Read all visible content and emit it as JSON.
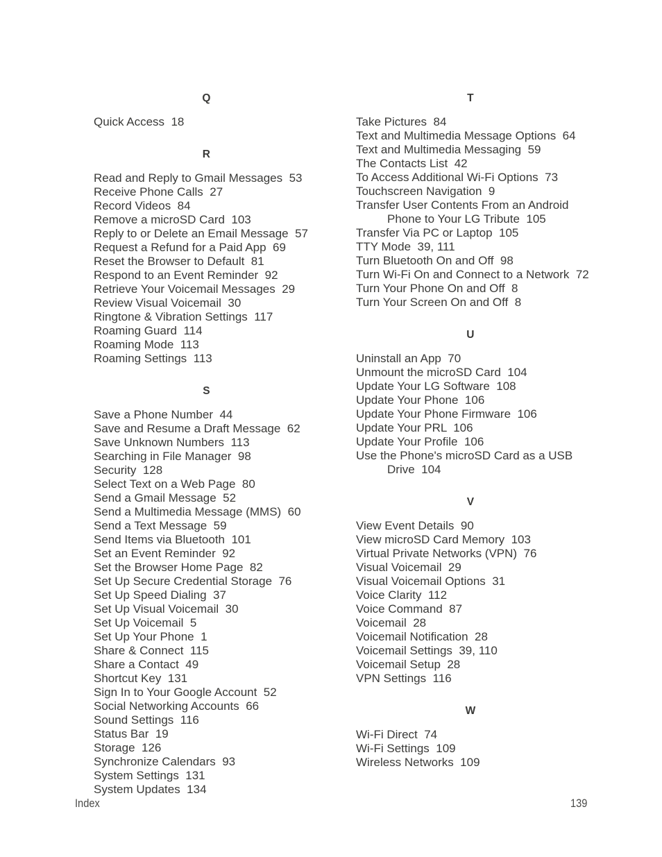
{
  "document": {
    "kind": "book-index-page",
    "page_number": "139",
    "footer_label": "Index"
  },
  "columns": [
    {
      "id": "left",
      "groups": [
        {
          "letter": "Q",
          "entries": [
            {
              "text": "Quick Access  18"
            }
          ]
        },
        {
          "letter": "R",
          "entries": [
            {
              "text": "Read and Reply to Gmail Messages  53"
            },
            {
              "text": "Receive Phone Calls  27"
            },
            {
              "text": "Record Videos  84"
            },
            {
              "text": "Remove a microSD Card  103"
            },
            {
              "text": "Reply to or Delete an Email Message  57"
            },
            {
              "text": "Request a Refund for a Paid App  69"
            },
            {
              "text": "Reset the Browser to Default  81"
            },
            {
              "text": "Respond to an Event Reminder  92"
            },
            {
              "text": "Retrieve Your Voicemail Messages  29"
            },
            {
              "text": "Review Visual Voicemail  30"
            },
            {
              "text": "Ringtone & Vibration Settings  117"
            },
            {
              "text": "Roaming Guard  114"
            },
            {
              "text": "Roaming Mode  113"
            },
            {
              "text": "Roaming Settings  113"
            }
          ]
        },
        {
          "letter": "S",
          "entries": [
            {
              "text": "Save a Phone Number  44"
            },
            {
              "text": "Save and Resume a Draft Message  62"
            },
            {
              "text": "Save Unknown Numbers  113"
            },
            {
              "text": "Searching in File Manager  98"
            },
            {
              "text": "Security  128"
            },
            {
              "text": "Select Text on a Web Page  80"
            },
            {
              "text": "Send a Gmail Message  52"
            },
            {
              "text": "Send a Multimedia Message (MMS)  60"
            },
            {
              "text": "Send a Text Message  59"
            },
            {
              "text": "Send Items via Bluetooth  101"
            },
            {
              "text": "Set an Event Reminder  92"
            },
            {
              "text": "Set the Browser Home Page  82"
            },
            {
              "text": "Set Up Secure Credential Storage  76"
            },
            {
              "text": "Set Up Speed Dialing  37"
            },
            {
              "text": "Set Up Visual Voicemail  30"
            },
            {
              "text": "Set Up Voicemail  5"
            },
            {
              "text": "Set Up Your Phone  1"
            },
            {
              "text": "Share & Connect  115"
            },
            {
              "text": "Share a Contact  49"
            },
            {
              "text": "Shortcut Key  131"
            },
            {
              "text": "Sign In to Your Google Account  52"
            },
            {
              "text": "Social Networking Accounts  66"
            },
            {
              "text": "Sound Settings  116"
            },
            {
              "text": "Status Bar  19"
            },
            {
              "text": "Storage  126"
            },
            {
              "text": "Synchronize Calendars  93"
            },
            {
              "text": "System Settings  131"
            },
            {
              "text": "System Updates  134"
            }
          ]
        }
      ]
    },
    {
      "id": "right",
      "groups": [
        {
          "letter": "T",
          "entries": [
            {
              "text": "Take Pictures  84"
            },
            {
              "text": "Text and Multimedia Message Options  64"
            },
            {
              "text": "Text and Multimedia Messaging  59"
            },
            {
              "text": "The Contacts List  42"
            },
            {
              "text": "To Access Additional Wi-Fi Options  73"
            },
            {
              "text": "Touchscreen Navigation  9"
            },
            {
              "text": "Transfer User Contents From an Android"
            },
            {
              "text": "Phone to Your LG Tribute  105",
              "continuation": true
            },
            {
              "text": "Transfer Via PC or Laptop  105"
            },
            {
              "text": "TTY Mode  39, 111"
            },
            {
              "text": "Turn Bluetooth On and Off  98"
            },
            {
              "text": "Turn Wi-Fi On and Connect to a Network  72"
            },
            {
              "text": "Turn Your Phone On and Off  8"
            },
            {
              "text": "Turn Your Screen On and Off  8"
            }
          ]
        },
        {
          "letter": "U",
          "entries": [
            {
              "text": "Uninstall an App  70"
            },
            {
              "text": "Unmount the microSD Card  104"
            },
            {
              "text": "Update Your LG Software  108"
            },
            {
              "text": "Update Your Phone  106"
            },
            {
              "text": "Update Your Phone Firmware  106"
            },
            {
              "text": "Update Your PRL  106"
            },
            {
              "text": "Update Your Profile  106"
            },
            {
              "text": "Use the Phone's microSD Card as a USB"
            },
            {
              "text": "Drive  104",
              "continuation": true
            }
          ]
        },
        {
          "letter": "V",
          "entries": [
            {
              "text": "View Event Details  90"
            },
            {
              "text": "View microSD Card Memory  103"
            },
            {
              "text": "Virtual Private Networks (VPN)  76"
            },
            {
              "text": "Visual Voicemail  29"
            },
            {
              "text": "Visual Voicemail Options  31"
            },
            {
              "text": "Voice Clarity  112"
            },
            {
              "text": "Voice Command  87"
            },
            {
              "text": "Voicemail  28"
            },
            {
              "text": "Voicemail Notification  28"
            },
            {
              "text": "Voicemail Settings  39, 110"
            },
            {
              "text": "Voicemail Setup  28"
            },
            {
              "text": "VPN Settings  116"
            }
          ]
        },
        {
          "letter": "W",
          "entries": [
            {
              "text": "Wi-Fi Direct  74"
            },
            {
              "text": "Wi-Fi Settings  109"
            },
            {
              "text": "Wireless Networks  109"
            }
          ]
        }
      ]
    }
  ],
  "colors": {
    "text": "#3a3a38",
    "background": "#ffffff"
  }
}
